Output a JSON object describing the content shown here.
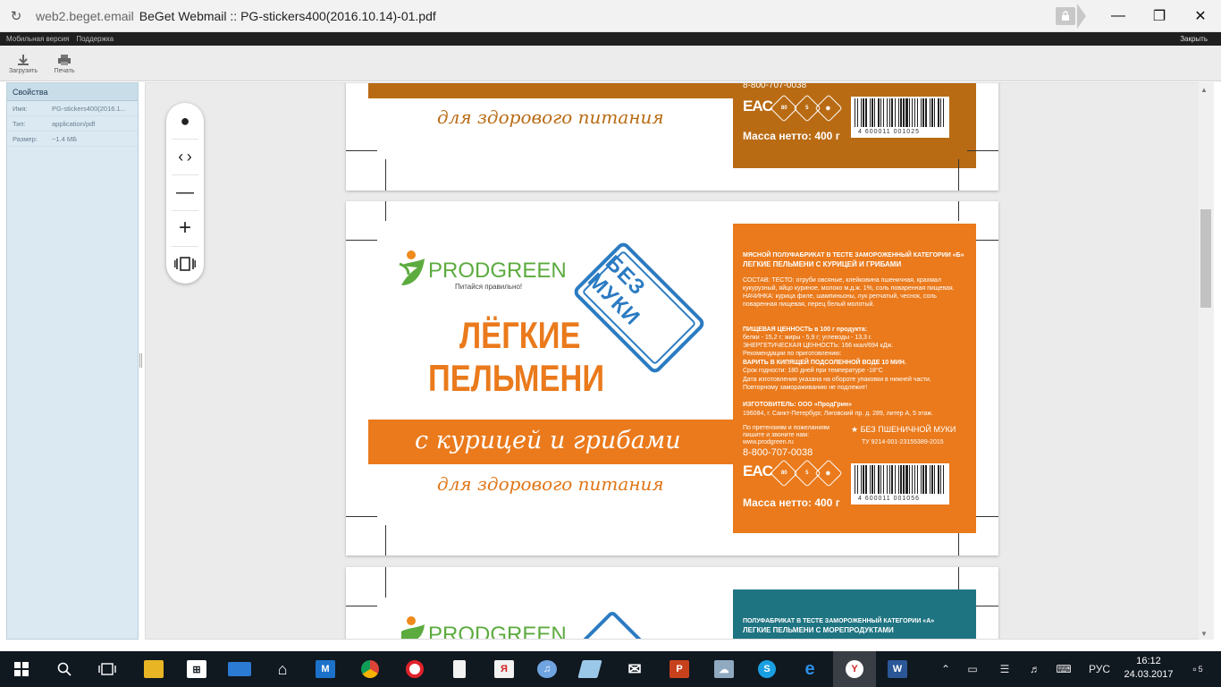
{
  "window": {
    "url": "web2.beget.email",
    "title": "BeGet Webmail :: PG-stickers400(2016.10.14)-01.pdf",
    "controls": {
      "minimize": "—",
      "maximize": "❐",
      "close": "✕"
    }
  },
  "mailbar": {
    "links": [
      "Мобильная версия",
      "Поддержка"
    ],
    "close": "Закрыть"
  },
  "toolbar": {
    "download": "Загрузить",
    "print": "Печать"
  },
  "properties": {
    "header": "Свойства",
    "rows": [
      {
        "key": "Имя:",
        "value": "PG-stickers400(2016.1..."
      },
      {
        "key": "Тип:",
        "value": "application/pdf"
      },
      {
        "key": "Размер:",
        "value": "~1.4 МБ"
      }
    ]
  },
  "pdf": {
    "page1": {
      "tagline": "для здорового питания",
      "phone": "8-800-707-0038",
      "massa": "Масса нетто: 400 г",
      "barcode": "4 600011 001025"
    },
    "page2": {
      "brand_prod": "PROD",
      "brand_green": "GREEN",
      "brand_slogan": "Питайся правильно!",
      "product_line1": "ЛЁГКИЕ",
      "product_line2": "ПЕЛЬМЕНИ",
      "stamp": "БЕЗ МУКИ",
      "flavor": "с курицей и грибами",
      "tagline": "для здорового питания",
      "label_category": "МЯСНОЙ ПОЛУФАБРИКАТ В ТЕСТЕ ЗАМОРОЖЕННЫЙ КАТЕГОРИИ «Б»",
      "label_name": "ЛЕГКИЕ ПЕЛЬМЕНИ С КУРИЦЕЙ И ГРИБАМИ",
      "label_composition": "СОСТАВ: ТЕСТО: отруби овсяные, клейковина пшеничная, крахмал кукурузный, яйцо куриное, молоко м.д.ж. 1%, соль поваренная пищевая. НАЧИНКА: курица филе, шампиньоны, лук репчатый, чеснок, соль поваренная пищевая, перец белый молотый.",
      "label_nutrition_title": "ПИЩЕВАЯ ЦЕННОСТЬ в 100 г продукта:",
      "label_nutrition": "белки - 15,2 г; жиры - 5,9 г; углеводы - 13,3 г.",
      "label_energy": "ЭНЕРГЕТИЧЕСКАЯ ЦЕННОСТЬ: 166 ккал/694 кДж.",
      "label_recommend": "Рекомендации по приготовлению:",
      "label_cook": "ВАРИТЬ В КИПЯЩЕЙ ПОДСОЛЕННОЙ ВОДЕ 10 МИН.",
      "label_shelf": "Срок годности: 180 дней при температуре -18°С",
      "label_date": "Дата изготовления указана на обороте упаковки в нижней части.",
      "label_refreeze": "Повторному замораживанию не подлежит!",
      "label_maker": "ИЗГОТОВИТЕЛЬ: ООО «ПродГрин»",
      "label_address": "196084, г. Санкт-Петербург, Лиговский пр. д. 289, литер А, 5 этаж.",
      "label_claims1": "По претензиям и пожеланиям",
      "label_claims2": "пишите и звоните нам:",
      "label_site": "www.prodgreen.ru",
      "label_no_wheat": "БЕЗ ПШЕНИЧНОЙ МУКИ",
      "label_tu": "ТУ 9214-001-23155389-2015",
      "phone": "8-800-707-0038",
      "massa": "Масса нетто: 400 г",
      "barcode": "4 600011 001056",
      "eac": "EAC"
    },
    "page3": {
      "brand_prod": "PROD",
      "brand_green": "GREEN",
      "label_category": "ПОЛУФАБРИКАТ В ТЕСТЕ ЗАМОРОЖЕННЫЙ КАТЕГОРИИ «А»",
      "label_name": "ЛЕГКИЕ ПЕЛЬМЕНИ С МОРЕПРОДУКТАМИ"
    }
  },
  "taskbar": {
    "lang": "РУС",
    "time": "16:12",
    "date": "24.03.2017",
    "notifications": "5",
    "apps": [
      "start",
      "search",
      "task-view",
      "file-explorer",
      "store",
      "lenovo",
      "home",
      "maxthon",
      "chrome",
      "opera",
      "file",
      "yandex-disk",
      "audio",
      "notes",
      "mail",
      "powerpoint",
      "photos",
      "skype",
      "edge",
      "yandex-browser",
      "word"
    ],
    "colors": {
      "accent": "#ea7a1c",
      "brown": "#b96b14",
      "teal": "#1f7482",
      "taskbar": "#101820"
    }
  }
}
